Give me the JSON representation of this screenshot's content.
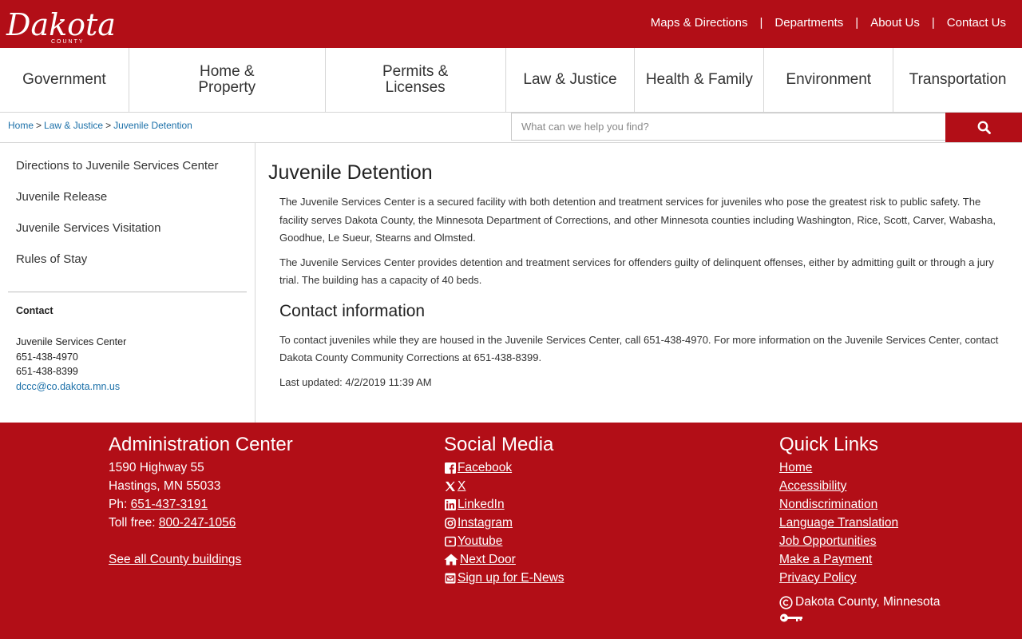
{
  "header": {
    "logo_text": "Dakota",
    "logo_subtext": "COUNTY",
    "utility_links": [
      "Maps & Directions",
      "Departments",
      "About Us",
      "Contact Us"
    ],
    "separator": "|"
  },
  "mainnav": {
    "items": [
      "Government",
      "Home & Property",
      "Permits & Licenses",
      "Law & Justice",
      "Health & Family",
      "Environment",
      "Transportation"
    ]
  },
  "breadcrumb": {
    "items": [
      "Home",
      "Law & Justice",
      "Juvenile Detention"
    ],
    "separator": ">"
  },
  "search": {
    "placeholder": "What can we help you find?"
  },
  "sidebar": {
    "links": [
      "Directions to Juvenile Services Center",
      "Juvenile Release",
      "Juvenile Services Visitation",
      "Rules of Stay"
    ],
    "contact": {
      "heading": "Contact",
      "name": "Juvenile Services Center",
      "phone1": "651-438-4970",
      "phone2": "651-438-8399",
      "email": "dccc@co.dakota.mn.us"
    }
  },
  "content": {
    "title": "Juvenile Detention",
    "para1": "The Juvenile Services Center is a secured facility with both detention and treatment services for juveniles who pose the greatest risk to public safety. The facility serves Dakota County, the Minnesota Department of Corrections, and other Minnesota counties including Washington, Rice, Scott, Carver, Wabasha, Goodhue, Le Sueur, Stearns and Olmsted.",
    "para2": "The Juvenile Services Center provides detention and treatment services for offenders guilty of delinquent offenses, either by admitting guilt or through a jury trial. The building has a capacity of 40 beds.",
    "subtitle": "Contact information",
    "para3": "To contact juveniles while they are housed in the Juvenile Services Center, call 651-438-4970.  For more information on the Juvenile Services Center, contact Dakota County Community Corrections at 651-438-8399.",
    "updated": "Last updated: 4/2/2019 11:39 AM"
  },
  "footer": {
    "admin": {
      "heading": "Administration Center",
      "address1": "1590 Highway 55",
      "address2": "Hastings, MN 55033",
      "phone_label": "Ph: ",
      "phone": "651-437-3191",
      "tollfree_label": "Toll free: ",
      "tollfree": "800-247-1056",
      "buildings_link": "See all County buildings"
    },
    "social": {
      "heading": "Social Media",
      "links": [
        {
          "label": "Facebook",
          "icon": "facebook-icon"
        },
        {
          "label": "X",
          "icon": "x-icon"
        },
        {
          "label": "LinkedIn",
          "icon": "linkedin-icon"
        },
        {
          "label": "Instagram",
          "icon": "instagram-icon"
        },
        {
          "label": "Youtube",
          "icon": "youtube-icon"
        },
        {
          "label": "Next Door",
          "icon": "home-icon"
        },
        {
          "label": "Sign up for E-News",
          "icon": "envelope-icon"
        }
      ]
    },
    "quick": {
      "heading": "Quick Links",
      "links": [
        "Home",
        "Accessibility",
        "Nondiscrimination",
        "Language Translation",
        "Job Opportunities",
        "Make a Payment",
        "Privacy Policy"
      ],
      "copyright": "Dakota County, Minnesota"
    }
  },
  "colors": {
    "brand_red": "#b20e17",
    "link_blue": "#1a6fa8"
  }
}
